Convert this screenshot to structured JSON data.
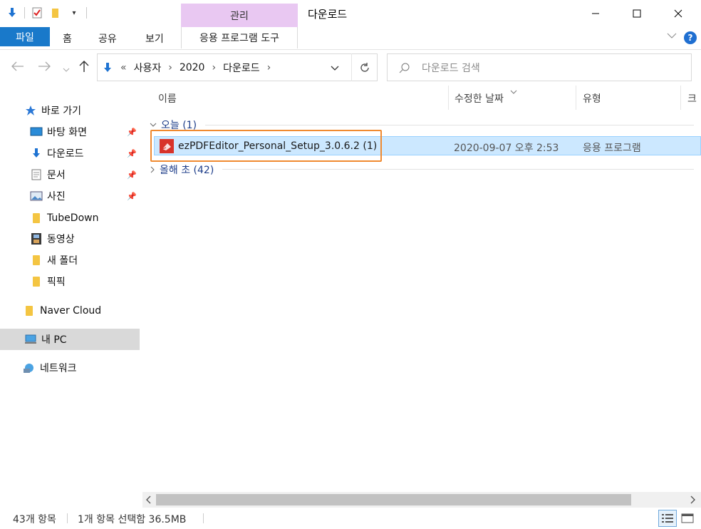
{
  "window": {
    "title": "다운로드",
    "context_tab": "관리",
    "minimize": "—",
    "maximize": "☐",
    "close": "✕"
  },
  "ribbon": {
    "tabs": [
      "파일",
      "홈",
      "공유",
      "보기"
    ],
    "app_tools": "응용 프로그램 도구"
  },
  "address": {
    "prefix": "«",
    "crumbs": [
      "사용자",
      "2020",
      "다운로드"
    ],
    "search_placeholder": "다운로드 검색"
  },
  "nav": {
    "quick_access": "바로 가기",
    "items": [
      {
        "label": "바탕 화면",
        "icon": "desktop-icon",
        "pinned": true
      },
      {
        "label": "다운로드",
        "icon": "download-icon",
        "pinned": true
      },
      {
        "label": "문서",
        "icon": "document-icon",
        "pinned": true
      },
      {
        "label": "사진",
        "icon": "picture-icon",
        "pinned": true
      },
      {
        "label": "TubeDown",
        "icon": "folder-icon",
        "pinned": false
      },
      {
        "label": "동영상",
        "icon": "video-icon",
        "pinned": false
      },
      {
        "label": "새 폴더",
        "icon": "folder-icon",
        "pinned": false
      },
      {
        "label": "픽픽",
        "icon": "folder-icon",
        "pinned": false
      }
    ],
    "naver_cloud": "Naver Cloud",
    "this_pc": "내 PC",
    "network": "네트워크"
  },
  "list": {
    "columns": [
      "이름",
      "수정한 날짜",
      "유형",
      "크"
    ],
    "groups": [
      {
        "label": "오늘 (1)",
        "expanded": true
      },
      {
        "label": "올해 초 (42)",
        "expanded": false
      }
    ],
    "rows": [
      {
        "name": "ezPDFEditor_Personal_Setup_3.0.6.2 (1)",
        "date": "2020-09-07 오후 2:53",
        "type": "응용 프로그램"
      }
    ]
  },
  "status": {
    "count": "43개 항목",
    "selection": "1개 항목 선택함 36.5MB"
  },
  "colors": {
    "accent": "#1979ca",
    "selection": "#cce8ff",
    "highlight_box": "#f08a30",
    "context_tab": "#e9c8f2"
  }
}
